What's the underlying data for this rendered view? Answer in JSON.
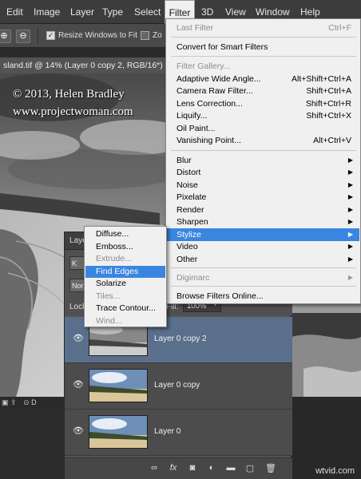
{
  "menubar": {
    "items": [
      "Edit",
      "Image",
      "Layer",
      "Type",
      "Select",
      "Filter",
      "3D",
      "View",
      "Window",
      "Help"
    ],
    "active": "Filter"
  },
  "options": {
    "resize_label": "Resize Windows to Fit",
    "zoom_partial": "Zo"
  },
  "document": {
    "tab": "sland.tif @ 14% (Layer 0 copy 2, RGB/16*) *",
    "watermark_line1": "© 2013, Helen Bradley",
    "watermark_line2": "www.projectwoman.com",
    "status_partial": "D"
  },
  "filter_menu": {
    "last_filter": "Last Filter",
    "last_filter_sc": "Ctrl+F",
    "convert": "Convert for Smart Filters",
    "gallery": "Filter Gallery...",
    "adaptive": "Adaptive Wide Angle...",
    "adaptive_sc": "Alt+Shift+Ctrl+A",
    "camera": "Camera Raw Filter...",
    "camera_sc": "Shift+Ctrl+A",
    "lens": "Lens Correction...",
    "lens_sc": "Shift+Ctrl+R",
    "liquify": "Liquify...",
    "liquify_sc": "Shift+Ctrl+X",
    "oil": "Oil Paint...",
    "vanishing": "Vanishing Point...",
    "vanishing_sc": "Alt+Ctrl+V",
    "blur": "Blur",
    "distort": "Distort",
    "noise": "Noise",
    "pixelate": "Pixelate",
    "render": "Render",
    "sharpen": "Sharpen",
    "stylize": "Stylize",
    "video": "Video",
    "other": "Other",
    "digimarc": "Digimarc",
    "browse": "Browse Filters Online..."
  },
  "stylize_menu": {
    "diffuse": "Diffuse...",
    "emboss": "Emboss...",
    "extrude": "Extrude...",
    "find_edges": "Find Edges",
    "solarize": "Solarize",
    "tiles": "Tiles...",
    "trace": "Trace Contour...",
    "wind": "Wind..."
  },
  "layers_panel": {
    "tab_partial": "Layer",
    "kind_partial": "K",
    "blend_partial": "Nor",
    "lock": "Lock:",
    "fill_label": "Fill:",
    "fill_value": "100%",
    "layers": [
      "Layer 0 copy 2",
      "Layer 0 copy",
      "Layer 0"
    ],
    "selected_index": 0
  },
  "watermark_corner": "wtvid.com",
  "colors": {
    "menu_bg": "#f0f0f0",
    "highlight": "#3a85e0",
    "panel": "#535353",
    "selected_layer": "#5a6f8c"
  }
}
